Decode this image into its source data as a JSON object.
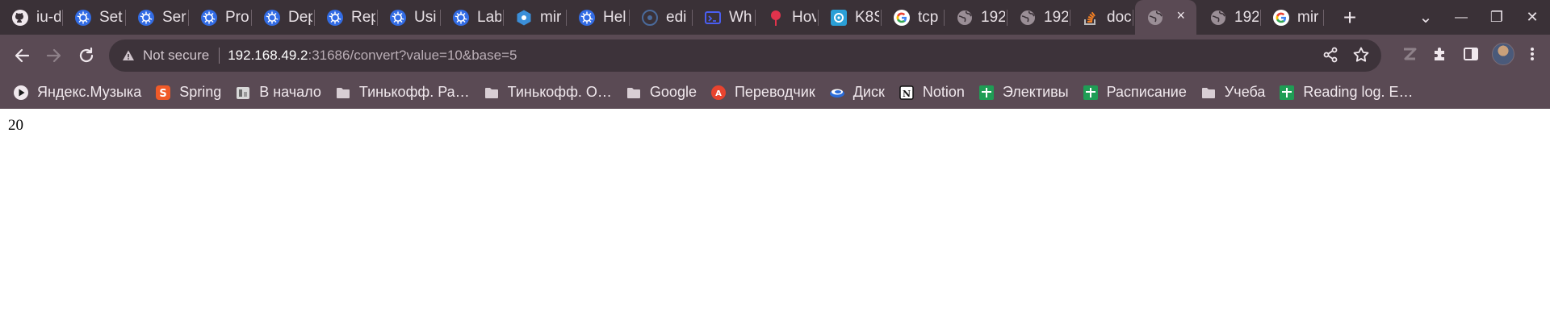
{
  "tabs": [
    {
      "title": "iu-d",
      "icon": "github-icon",
      "color": "#2b2b2b"
    },
    {
      "title": "Set",
      "icon": "kubernetes-icon",
      "color": "#326ce5"
    },
    {
      "title": "Ser",
      "icon": "kubernetes-icon",
      "color": "#326ce5"
    },
    {
      "title": "Pro",
      "icon": "kubernetes-icon",
      "color": "#326ce5"
    },
    {
      "title": "Dep",
      "icon": "kubernetes-icon",
      "color": "#326ce5"
    },
    {
      "title": "Rep",
      "icon": "kubernetes-icon",
      "color": "#326ce5"
    },
    {
      "title": "Usi",
      "icon": "kubernetes-icon",
      "color": "#326ce5"
    },
    {
      "title": "Lab",
      "icon": "kubernetes-icon",
      "color": "#326ce5"
    },
    {
      "title": "mir",
      "icon": "minikube-icon",
      "color": "#3b8fd9"
    },
    {
      "title": "Hel",
      "icon": "kubernetes-icon",
      "color": "#326ce5"
    },
    {
      "title": "edi",
      "icon": "edit-icon",
      "color": "#2b3a55"
    },
    {
      "title": "Wh",
      "icon": "window-icon",
      "color": "#3b52d6"
    },
    {
      "title": "Hov",
      "icon": "pin-icon",
      "color": "#e2334c"
    },
    {
      "title": "K8S",
      "icon": "k8s-icon",
      "color": "#2a9fd6"
    },
    {
      "title": "tcp",
      "icon": "google-icon",
      "color": "#ffffff"
    },
    {
      "title": "192",
      "icon": "globe-icon",
      "color": "#8b7f87"
    },
    {
      "title": "192",
      "icon": "globe-icon",
      "color": "#8b7f87"
    },
    {
      "title": "doc",
      "icon": "stackoverflow-icon",
      "color": "#f48024"
    },
    {
      "title": "",
      "icon": "globe-icon",
      "color": "#8b7f87",
      "active": true
    },
    {
      "title": "192",
      "icon": "globe-icon",
      "color": "#8b7f87"
    },
    {
      "title": "mir",
      "icon": "google-icon",
      "color": "#ffffff"
    }
  ],
  "active_tab_close": "×",
  "new_tab_label": "+",
  "window_controls": {
    "dropdown": "⌄",
    "minimize": "—",
    "maximize": "❐",
    "close": "✕"
  },
  "toolbar": {
    "not_secure_label": "Not secure",
    "url_host": "192.168.49.2",
    "url_rest": ":31686/convert?value=10&base=5"
  },
  "bookmarks": [
    {
      "label": "Яндекс.Музыка",
      "icon": "play-icon"
    },
    {
      "label": "Spring",
      "icon": "s-icon"
    },
    {
      "label": "В начало",
      "icon": "home-icon"
    },
    {
      "label": "Тинькофф. Ра…",
      "icon": "folder-icon"
    },
    {
      "label": "Тинькофф. О…",
      "icon": "folder-icon"
    },
    {
      "label": "Google",
      "icon": "folder-icon"
    },
    {
      "label": "Переводчик",
      "icon": "translate-icon"
    },
    {
      "label": "Диск",
      "icon": "disk-icon"
    },
    {
      "label": "Notion",
      "icon": "notion-icon"
    },
    {
      "label": "Элективы",
      "icon": "plus-green-icon"
    },
    {
      "label": "Расписание",
      "icon": "plus-green-icon"
    },
    {
      "label": "Учеба",
      "icon": "folder-icon"
    },
    {
      "label": "Reading log. E…",
      "icon": "plus-green-icon"
    }
  ],
  "page": {
    "result": "20"
  }
}
